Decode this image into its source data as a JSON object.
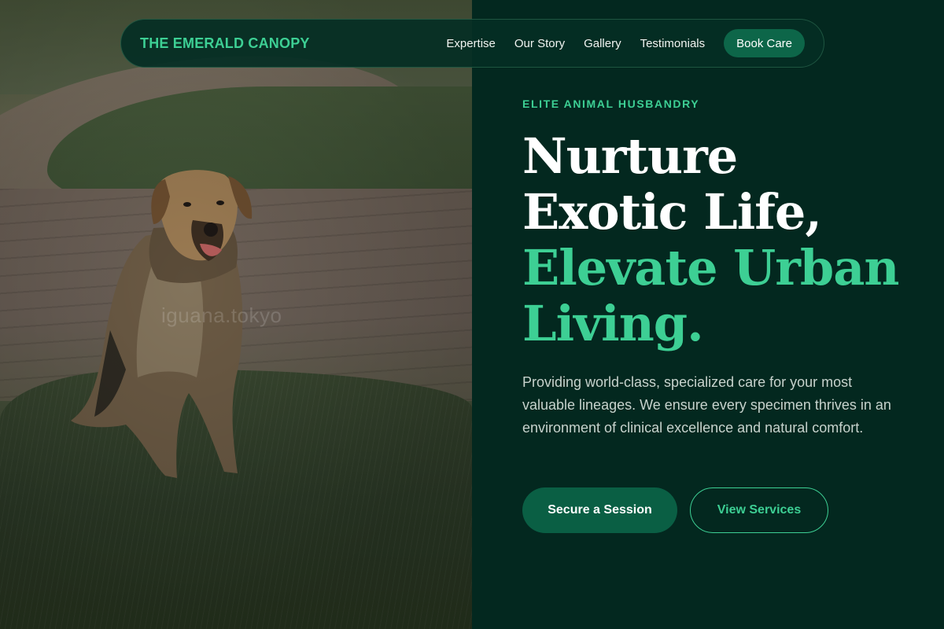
{
  "photo": {
    "alt": "Dog sitting on grass beside a brick path",
    "watermark": "iguana.tokyo"
  },
  "nav": {
    "brand": "THE EMERALD CANOPY",
    "links": [
      "Expertise",
      "Our Story",
      "Gallery",
      "Testimonials"
    ],
    "cta": "Book Care"
  },
  "hero": {
    "eyebrow": "ELITE ANIMAL HUSBANDRY",
    "headline_line1": "Nurture",
    "headline_line2": "Exotic Life,",
    "headline_line3": "Elevate Urban",
    "headline_line4": "Living.",
    "description": "Providing world-class, specialized care for your most valuable lineages. We ensure every specimen thrives in an environment of clinical excellence and natural comfort.",
    "primary_button": "Secure a Session",
    "secondary_button": "View Services"
  },
  "colors": {
    "background": "#03281f",
    "accent": "#3dcf94",
    "button": "#0a5f44"
  }
}
